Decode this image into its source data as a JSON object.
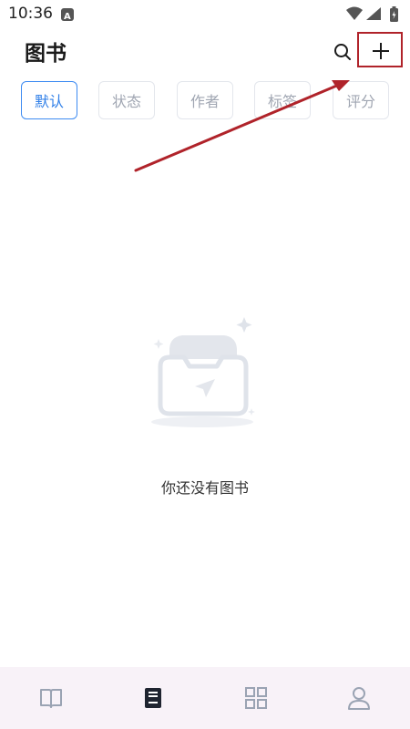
{
  "status_bar": {
    "time": "10:36",
    "icons": [
      "text-badge-icon",
      "wifi-icon",
      "signal-icon",
      "battery-charging-icon"
    ]
  },
  "header": {
    "title": "图书",
    "search_icon": "search-icon",
    "add_icon": "plus-icon"
  },
  "filters": [
    {
      "label": "默认",
      "active": true
    },
    {
      "label": "状态",
      "active": false
    },
    {
      "label": "作者",
      "active": false
    },
    {
      "label": "标签",
      "active": false
    },
    {
      "label": "评分",
      "active": false
    }
  ],
  "empty_state": {
    "icon": "empty-inbox-icon",
    "message": "你还没有图书"
  },
  "bottom_nav": [
    {
      "icon": "open-book-icon",
      "active": false
    },
    {
      "icon": "bookshelf-icon",
      "active": true
    },
    {
      "icon": "grid-icon",
      "active": false
    },
    {
      "icon": "person-icon",
      "active": false
    }
  ],
  "colors": {
    "accent": "#2f7fe8",
    "annotation": "#b0232a",
    "nav_background": "#f8f2f8",
    "inactive_chip_text": "#a0a6b2"
  }
}
